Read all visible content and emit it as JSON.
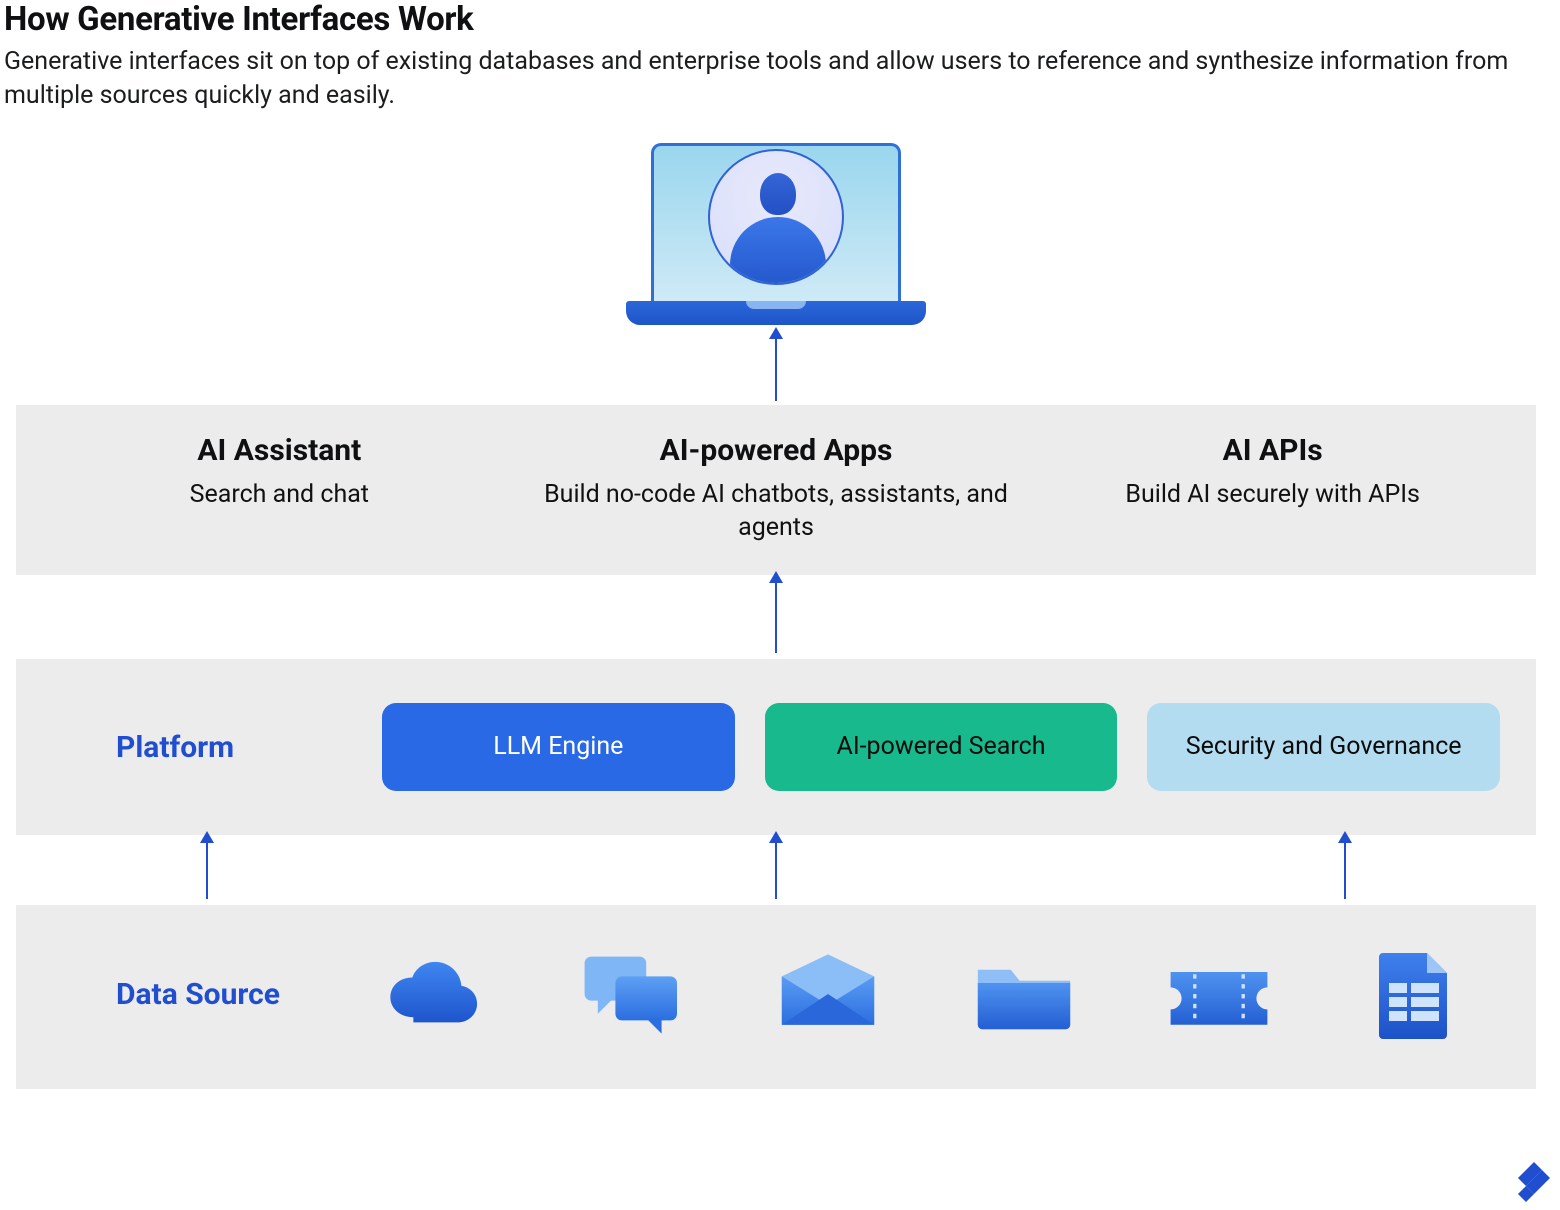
{
  "header": {
    "title": "How Generative Interfaces Work",
    "subtitle": "Generative interfaces sit on top of existing databases and enterprise tools and allow users to reference and synthesize information from multiple sources quickly and easily."
  },
  "ai_layer": {
    "cols": [
      {
        "title": "AI Assistant",
        "desc": "Search and chat"
      },
      {
        "title": "AI-powered Apps",
        "desc": "Build no-code AI chatbots, assistants, and agents"
      },
      {
        "title": "AI APIs",
        "desc": "Build AI securely with APIs"
      }
    ]
  },
  "platform": {
    "label": "Platform",
    "pills": [
      {
        "label": "LLM Engine",
        "class": "pill-blue"
      },
      {
        "label": "AI-powered Search",
        "class": "pill-green"
      },
      {
        "label": "Security and Governance",
        "class": "pill-light"
      }
    ]
  },
  "data_source": {
    "label": "Data Source",
    "icons": [
      "cloud-icon",
      "chat-icon",
      "mail-icon",
      "folder-icon",
      "ticket-icon",
      "spreadsheet-icon"
    ]
  },
  "colors": {
    "accent": "#204ecf",
    "band": "#ececed",
    "pill_blue": "#2969e6",
    "pill_green": "#17b98d",
    "pill_light": "#b4dcf0"
  }
}
